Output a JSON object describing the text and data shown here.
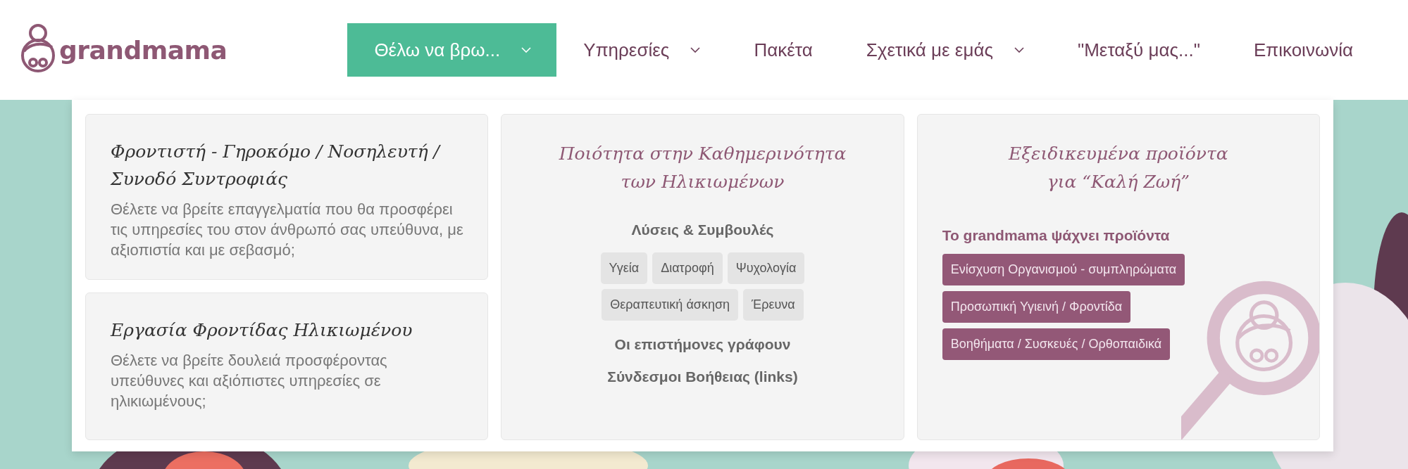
{
  "logo": {
    "text": "grandmama"
  },
  "nav": [
    {
      "label": "Θέλω να βρω...",
      "selected": true,
      "dropdown": true
    },
    {
      "label": "Υπηρεσίες",
      "selected": false,
      "dropdown": true
    },
    {
      "label": "Πακέτα",
      "selected": false,
      "dropdown": false
    },
    {
      "label": "Σχετικά με εμάς",
      "selected": false,
      "dropdown": true
    },
    {
      "label": "\"Μεταξύ μας...\"",
      "selected": false,
      "dropdown": false
    },
    {
      "label": "Επικοινωνία",
      "selected": false,
      "dropdown": false
    }
  ],
  "menu": {
    "offers": [
      {
        "title": "Φροντιστή - Γηροκόμο / Νοσηλευτή / Συνοδό Συντροφιάς",
        "description": "Θέλετε να βρείτε επαγγελματία που θα προσφέρει τις υπηρεσίες του στον άνθρωπό σας υπεύθυνα, με αξιοπιστία και με σεβασμό;"
      },
      {
        "title": "Εργασία Φροντίδας Ηλικιωμένου",
        "description": "Θέλετε να βρείτε δουλειά προσφέροντας υπεύθυνες και αξιόπιστες υπηρεσίες σε ηλικιωμένους;"
      }
    ],
    "quality": {
      "title_lines": [
        "Ποιότητα στην Καθημερινότητα",
        "των Ηλικιωμένων"
      ],
      "tips_heading": "Λύσεις & Συμβουλές",
      "tags": [
        "Υγεία",
        "Διατροφή",
        "Ψυχολογία",
        "Θεραπευτική άσκηση",
        "Έρευνα"
      ],
      "links": [
        "Οι επιστήμονες γράφουν",
        "Σύνδεσμοι Βοήθειας (links)"
      ]
    },
    "products": {
      "title_lines": [
        "Εξειδικευμένα προϊόντα",
        "για “Καλή Ζωή”"
      ],
      "heading": "Το grandmama ψάχνει προϊόντα",
      "categories": [
        "Ενίσχυση Οργανισμού - συμπληρώματα",
        "Προσωπική Υγιεινή / Φροντίδα",
        "Βοηθήματα / Συσκευές / Ορθοπαιδικά"
      ]
    }
  }
}
